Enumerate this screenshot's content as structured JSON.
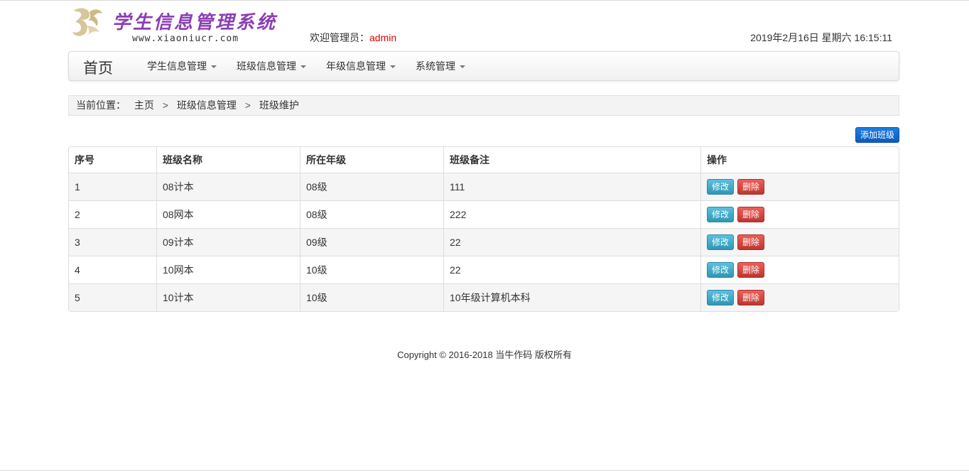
{
  "header": {
    "logo_title": "学生信息管理系统",
    "logo_url": "www.xiaoniucr.com",
    "welcome_prefix": "欢迎管理员：",
    "username": "admin",
    "datetime": "2019年2月16日 星期六 16:15:11"
  },
  "nav": {
    "brand": "首页",
    "items": [
      {
        "label": "学生信息管理"
      },
      {
        "label": "班级信息管理"
      },
      {
        "label": "年级信息管理"
      },
      {
        "label": "系统管理"
      }
    ]
  },
  "breadcrumb": {
    "label": "当前位置：",
    "items": [
      "主页",
      "班级信息管理",
      "班级维护"
    ],
    "separator": ">"
  },
  "actions": {
    "add_label": "添加班级"
  },
  "table": {
    "headers": [
      "序号",
      "班级名称",
      "所在年级",
      "班级备注",
      "操作"
    ],
    "rows": [
      {
        "id": "1",
        "name": "08计本",
        "grade": "08级",
        "note": "111"
      },
      {
        "id": "2",
        "name": "08网本",
        "grade": "08级",
        "note": "222"
      },
      {
        "id": "3",
        "name": "09计本",
        "grade": "09级",
        "note": "22"
      },
      {
        "id": "4",
        "name": "10网本",
        "grade": "10级",
        "note": "22"
      },
      {
        "id": "5",
        "name": "10计本",
        "grade": "10级",
        "note": "10年级计算机本科"
      }
    ],
    "edit_label": "修改",
    "delete_label": "删除"
  },
  "footer": {
    "copyright": "Copyright © 2016-2018 当牛作码 版权所有"
  },
  "colors": {
    "accent_blue": "#0b5bbf",
    "edit": "#2f96b4",
    "delete": "#bd362f",
    "username": "#e00000",
    "logo": "#8a3fb5"
  },
  "icons": {
    "logo": "bird-logo-icon",
    "dropdown": "caret-down-icon"
  }
}
